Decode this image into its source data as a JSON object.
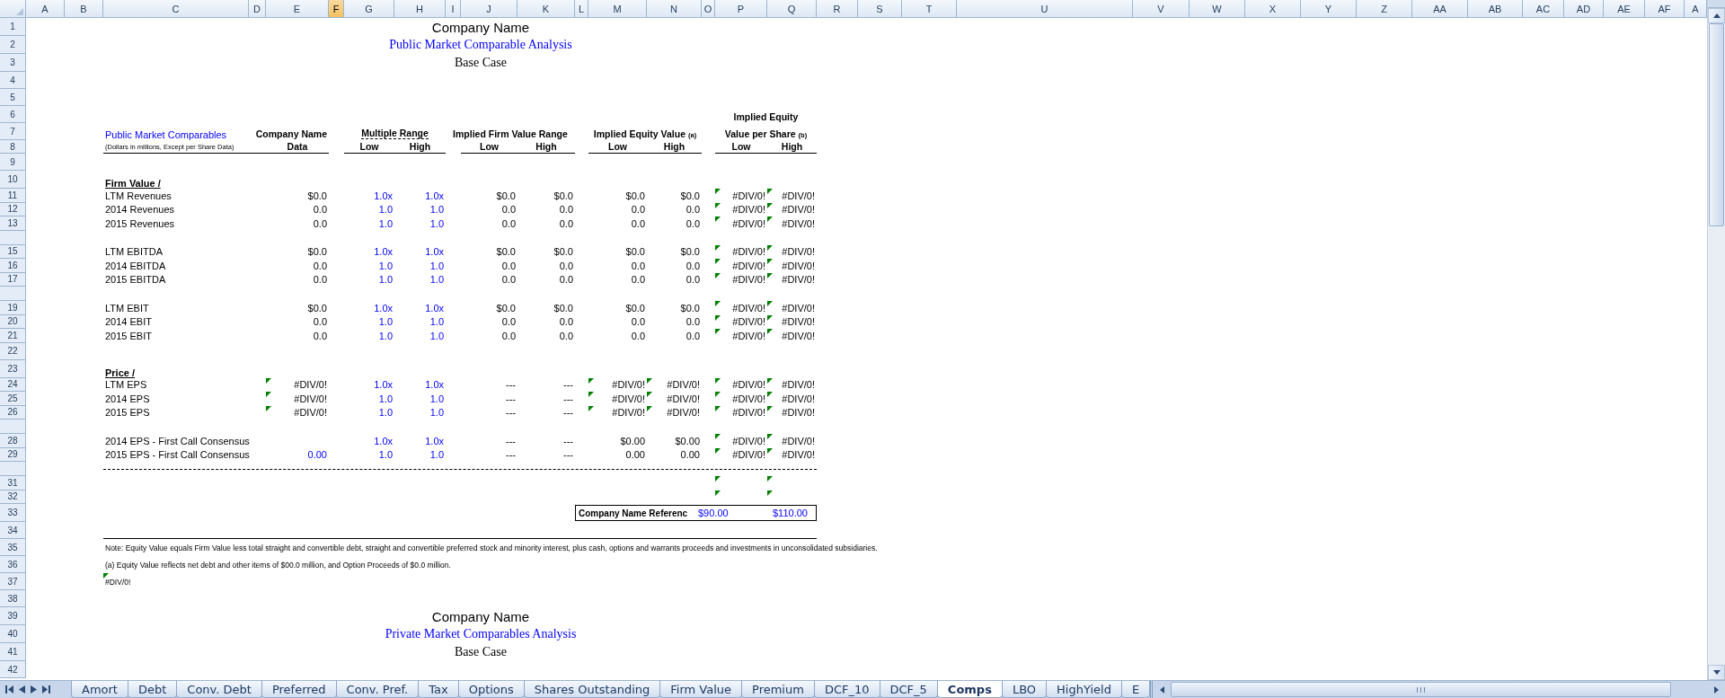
{
  "column_headers": [
    {
      "label": "A",
      "selected": false
    },
    {
      "label": "B",
      "selected": false
    },
    {
      "label": "C",
      "selected": false
    },
    {
      "label": "D",
      "selected": false
    },
    {
      "label": "E",
      "selected": false
    },
    {
      "label": "F",
      "selected": true
    },
    {
      "label": "G",
      "selected": false
    },
    {
      "label": "H",
      "selected": false
    },
    {
      "label": "I",
      "selected": false
    },
    {
      "label": "J",
      "selected": false
    },
    {
      "label": "K",
      "selected": false
    },
    {
      "label": "L",
      "selected": false
    },
    {
      "label": "M",
      "selected": false
    },
    {
      "label": "N",
      "selected": false
    },
    {
      "label": "O",
      "selected": false
    },
    {
      "label": "P",
      "selected": false
    },
    {
      "label": "Q",
      "selected": false
    },
    {
      "label": "R",
      "selected": false
    },
    {
      "label": "S",
      "selected": false
    },
    {
      "label": "T",
      "selected": false
    },
    {
      "label": "U",
      "selected": false
    },
    {
      "label": "V",
      "selected": false
    },
    {
      "label": "W",
      "selected": false
    },
    {
      "label": "X",
      "selected": false
    },
    {
      "label": "Y",
      "selected": false
    },
    {
      "label": "Z",
      "selected": false
    },
    {
      "label": "AA",
      "selected": false
    },
    {
      "label": "AB",
      "selected": false
    },
    {
      "label": "AC",
      "selected": false
    },
    {
      "label": "AD",
      "selected": false
    },
    {
      "label": "AE",
      "selected": false
    },
    {
      "label": "AF",
      "selected": false
    },
    {
      "label": "A",
      "selected": false
    }
  ],
  "sheet_rows": [
    {
      "kind": "heading",
      "number": "1",
      "text": "Company Name"
    },
    {
      "kind": "subtitle",
      "number": "2",
      "text": "Public Market Comparable Analysis"
    },
    {
      "kind": "caption",
      "number": "3",
      "text": "Base Case"
    },
    {
      "kind": "blank",
      "number": "4"
    },
    {
      "kind": "blank",
      "number": "5"
    },
    {
      "kind": "header_top",
      "number": "6",
      "text": "Implied Equity"
    },
    {
      "kind": "header",
      "number": "7",
      "section_title": "Public Market Comparables",
      "columns": [
        {
          "text": "Company Name"
        },
        {
          "text": "Multiple Range"
        },
        {
          "text": "Implied Firm Value Range"
        },
        {
          "text": "Implied Equity Value",
          "note": "(a)"
        },
        {
          "text": "Value per Share",
          "note": "(b)"
        }
      ]
    },
    {
      "kind": "subheader",
      "number": "8",
      "units": "(Dollars in millions, Except per Share Data)",
      "labels": [
        "Data",
        "Low",
        "High",
        "Low",
        "High",
        "Low",
        "High",
        "Low",
        "High"
      ]
    },
    {
      "kind": "blank",
      "number": "9"
    },
    {
      "kind": "section",
      "number": "10",
      "text": "Firm Value /"
    },
    {
      "kind": "metric",
      "number": "11",
      "label": "LTM Revenues",
      "cells": [
        {
          "text": "$0.0",
          "input": false,
          "flag": false
        },
        {
          "text": "1.0x",
          "input": true,
          "flag": false
        },
        {
          "text": "1.0x",
          "input": true,
          "flag": false
        },
        {
          "text": "$0.0",
          "input": false,
          "flag": false
        },
        {
          "text": "$0.0",
          "input": false,
          "flag": false
        },
        {
          "text": "$0.0",
          "input": false,
          "flag": false
        },
        {
          "text": "$0.0",
          "input": false,
          "flag": false
        },
        {
          "text": "#DIV/0!",
          "input": false,
          "flag": true
        },
        {
          "text": "#DIV/0!",
          "input": false,
          "flag": true
        }
      ]
    },
    {
      "kind": "metric",
      "number": "12",
      "label": "2014 Revenues",
      "cells": [
        {
          "text": "0.0",
          "input": false,
          "flag": false
        },
        {
          "text": "1.0",
          "input": true,
          "flag": false
        },
        {
          "text": "1.0",
          "input": true,
          "flag": false
        },
        {
          "text": "0.0",
          "input": false,
          "flag": false
        },
        {
          "text": "0.0",
          "input": false,
          "flag": false
        },
        {
          "text": "0.0",
          "input": false,
          "flag": false
        },
        {
          "text": "0.0",
          "input": false,
          "flag": false
        },
        {
          "text": "#DIV/0!",
          "input": false,
          "flag": true
        },
        {
          "text": "#DIV/0!",
          "input": false,
          "flag": true
        }
      ]
    },
    {
      "kind": "metric",
      "number": "13",
      "label": "2015 Revenues",
      "cells": [
        {
          "text": "0.0",
          "input": false,
          "flag": false
        },
        {
          "text": "1.0",
          "input": true,
          "flag": false
        },
        {
          "text": "1.0",
          "input": true,
          "flag": false
        },
        {
          "text": "0.0",
          "input": false,
          "flag": false
        },
        {
          "text": "0.0",
          "input": false,
          "flag": false
        },
        {
          "text": "0.0",
          "input": false,
          "flag": false
        },
        {
          "text": "0.0",
          "input": false,
          "flag": false
        },
        {
          "text": "#DIV/0!",
          "input": false,
          "flag": true
        },
        {
          "text": "#DIV/0!",
          "input": false,
          "flag": true
        }
      ]
    },
    {
      "kind": "spacer"
    },
    {
      "kind": "metric",
      "number": "15",
      "label": "LTM EBITDA",
      "cells": [
        {
          "text": "$0.0",
          "input": false,
          "flag": false
        },
        {
          "text": "1.0x",
          "input": true,
          "flag": false
        },
        {
          "text": "1.0x",
          "input": true,
          "flag": false
        },
        {
          "text": "$0.0",
          "input": false,
          "flag": false
        },
        {
          "text": "$0.0",
          "input": false,
          "flag": false
        },
        {
          "text": "$0.0",
          "input": false,
          "flag": false
        },
        {
          "text": "$0.0",
          "input": false,
          "flag": false
        },
        {
          "text": "#DIV/0!",
          "input": false,
          "flag": true
        },
        {
          "text": "#DIV/0!",
          "input": false,
          "flag": true
        }
      ]
    },
    {
      "kind": "metric",
      "number": "16",
      "label": "2014 EBITDA",
      "cells": [
        {
          "text": "0.0",
          "input": false,
          "flag": false
        },
        {
          "text": "1.0",
          "input": true,
          "flag": false
        },
        {
          "text": "1.0",
          "input": true,
          "flag": false
        },
        {
          "text": "0.0",
          "input": false,
          "flag": false
        },
        {
          "text": "0.0",
          "input": false,
          "flag": false
        },
        {
          "text": "0.0",
          "input": false,
          "flag": false
        },
        {
          "text": "0.0",
          "input": false,
          "flag": false
        },
        {
          "text": "#DIV/0!",
          "input": false,
          "flag": true
        },
        {
          "text": "#DIV/0!",
          "input": false,
          "flag": true
        }
      ]
    },
    {
      "kind": "metric",
      "number": "17",
      "label": "2015 EBITDA",
      "cells": [
        {
          "text": "0.0",
          "input": false,
          "flag": false
        },
        {
          "text": "1.0",
          "input": true,
          "flag": false
        },
        {
          "text": "1.0",
          "input": true,
          "flag": false
        },
        {
          "text": "0.0",
          "input": false,
          "flag": false
        },
        {
          "text": "0.0",
          "input": false,
          "flag": false
        },
        {
          "text": "0.0",
          "input": false,
          "flag": false
        },
        {
          "text": "0.0",
          "input": false,
          "flag": false
        },
        {
          "text": "#DIV/0!",
          "input": false,
          "flag": true
        },
        {
          "text": "#DIV/0!",
          "input": false,
          "flag": true
        }
      ]
    },
    {
      "kind": "spacer"
    },
    {
      "kind": "metric",
      "number": "19",
      "label": "LTM EBIT",
      "cells": [
        {
          "text": "$0.0",
          "input": false,
          "flag": false
        },
        {
          "text": "1.0x",
          "input": true,
          "flag": false
        },
        {
          "text": "1.0x",
          "input": true,
          "flag": false
        },
        {
          "text": "$0.0",
          "input": false,
          "flag": false
        },
        {
          "text": "$0.0",
          "input": false,
          "flag": false
        },
        {
          "text": "$0.0",
          "input": false,
          "flag": false
        },
        {
          "text": "$0.0",
          "input": false,
          "flag": false
        },
        {
          "text": "#DIV/0!",
          "input": false,
          "flag": true
        },
        {
          "text": "#DIV/0!",
          "input": false,
          "flag": true
        }
      ]
    },
    {
      "kind": "metric",
      "number": "20",
      "label": "2014 EBIT",
      "cells": [
        {
          "text": "0.0",
          "input": false,
          "flag": false
        },
        {
          "text": "1.0",
          "input": true,
          "flag": false
        },
        {
          "text": "1.0",
          "input": true,
          "flag": false
        },
        {
          "text": "0.0",
          "input": false,
          "flag": false
        },
        {
          "text": "0.0",
          "input": false,
          "flag": false
        },
        {
          "text": "0.0",
          "input": false,
          "flag": false
        },
        {
          "text": "0.0",
          "input": false,
          "flag": false
        },
        {
          "text": "#DIV/0!",
          "input": false,
          "flag": true
        },
        {
          "text": "#DIV/0!",
          "input": false,
          "flag": true
        }
      ]
    },
    {
      "kind": "metric",
      "number": "21",
      "label": "2015 EBIT",
      "cells": [
        {
          "text": "0.0",
          "input": false,
          "flag": false
        },
        {
          "text": "1.0",
          "input": true,
          "flag": false
        },
        {
          "text": "1.0",
          "input": true,
          "flag": false
        },
        {
          "text": "0.0",
          "input": false,
          "flag": false
        },
        {
          "text": "0.0",
          "input": false,
          "flag": false
        },
        {
          "text": "0.0",
          "input": false,
          "flag": false
        },
        {
          "text": "0.0",
          "input": false,
          "flag": false
        },
        {
          "text": "#DIV/0!",
          "input": false,
          "flag": true
        },
        {
          "text": "#DIV/0!",
          "input": false,
          "flag": true
        }
      ]
    },
    {
      "kind": "blank",
      "number": "22"
    },
    {
      "kind": "section",
      "number": "23",
      "text": "Price /"
    },
    {
      "kind": "metric",
      "number": "24",
      "label": "LTM EPS",
      "cells": [
        {
          "text": "#DIV/0!",
          "input": false,
          "flag": true
        },
        {
          "text": "1.0x",
          "input": true,
          "flag": false
        },
        {
          "text": "1.0x",
          "input": true,
          "flag": false
        },
        {
          "text": "---",
          "input": false,
          "flag": false
        },
        {
          "text": "---",
          "input": false,
          "flag": false
        },
        {
          "text": "#DIV/0!",
          "input": false,
          "flag": true
        },
        {
          "text": "#DIV/0!",
          "input": false,
          "flag": true
        },
        {
          "text": "#DIV/0!",
          "input": false,
          "flag": true
        },
        {
          "text": "#DIV/0!",
          "input": false,
          "flag": true
        }
      ]
    },
    {
      "kind": "metric",
      "number": "25",
      "label": "2014 EPS",
      "cells": [
        {
          "text": "#DIV/0!",
          "input": false,
          "flag": true
        },
        {
          "text": "1.0",
          "input": true,
          "flag": false
        },
        {
          "text": "1.0",
          "input": true,
          "flag": false
        },
        {
          "text": "---",
          "input": false,
          "flag": false
        },
        {
          "text": "---",
          "input": false,
          "flag": false
        },
        {
          "text": "#DIV/0!",
          "input": false,
          "flag": true
        },
        {
          "text": "#DIV/0!",
          "input": false,
          "flag": true
        },
        {
          "text": "#DIV/0!",
          "input": false,
          "flag": true
        },
        {
          "text": "#DIV/0!",
          "input": false,
          "flag": true
        }
      ]
    },
    {
      "kind": "metric",
      "number": "26",
      "label": "2015 EPS",
      "cells": [
        {
          "text": "#DIV/0!",
          "input": false,
          "flag": true
        },
        {
          "text": "1.0",
          "input": true,
          "flag": false
        },
        {
          "text": "1.0",
          "input": true,
          "flag": false
        },
        {
          "text": "---",
          "input": false,
          "flag": false
        },
        {
          "text": "---",
          "input": false,
          "flag": false
        },
        {
          "text": "#DIV/0!",
          "input": false,
          "flag": true
        },
        {
          "text": "#DIV/0!",
          "input": false,
          "flag": true
        },
        {
          "text": "#DIV/0!",
          "input": false,
          "flag": true
        },
        {
          "text": "#DIV/0!",
          "input": false,
          "flag": true
        }
      ]
    },
    {
      "kind": "spacer"
    },
    {
      "kind": "metric",
      "number": "28",
      "label": "2014 EPS - First Call Consensus",
      "cells": [
        null,
        {
          "text": "1.0x",
          "input": true,
          "flag": false
        },
        {
          "text": "1.0x",
          "input": true,
          "flag": false
        },
        {
          "text": "---",
          "input": false,
          "flag": false
        },
        {
          "text": "---",
          "input": false,
          "flag": false
        },
        {
          "text": "$0.00",
          "input": false,
          "flag": false
        },
        {
          "text": "$0.00",
          "input": false,
          "flag": false
        },
        {
          "text": "#DIV/0!",
          "input": false,
          "flag": true
        },
        {
          "text": "#DIV/0!",
          "input": false,
          "flag": true
        }
      ]
    },
    {
      "kind": "metric",
      "number": "29",
      "label": "2015 EPS - First Call Consensus",
      "cells": [
        {
          "text": "0.00",
          "input": true,
          "flag": false
        },
        {
          "text": "1.0",
          "input": true,
          "flag": false
        },
        {
          "text": "1.0",
          "input": true,
          "flag": false
        },
        {
          "text": "---",
          "input": false,
          "flag": false
        },
        {
          "text": "---",
          "input": false,
          "flag": false
        },
        {
          "text": "0.00",
          "input": false,
          "flag": false
        },
        {
          "text": "0.00",
          "input": false,
          "flag": false
        },
        {
          "text": "#DIV/0!",
          "input": false,
          "flag": true
        },
        {
          "text": "#DIV/0!",
          "input": false,
          "flag": true
        }
      ]
    },
    {
      "kind": "spacer",
      "dotted_rule": true
    },
    {
      "kind": "metric",
      "number": "31",
      "cells": [
        null,
        null,
        null,
        null,
        null,
        null,
        null,
        {
          "flag": true
        },
        {
          "flag": true
        }
      ]
    },
    {
      "kind": "metric",
      "number": "32",
      "cells": [
        null,
        null,
        null,
        null,
        null,
        null,
        null,
        {
          "flag": true
        },
        {
          "flag": true
        }
      ]
    },
    {
      "kind": "reference",
      "number": "33",
      "label": "Company Name Referenc",
      "values": [
        "$90.00",
        "$110.00"
      ]
    },
    {
      "kind": "blank",
      "number": "34",
      "rule_below": true
    },
    {
      "kind": "note",
      "number": "35",
      "text": "Note:  Equity Value equals Firm Value less total straight and convertible debt, straight and convertible preferred stock and minority interest, plus cash, options and warrants proceeds and investments in unconsolidated subsidiaries."
    },
    {
      "kind": "note",
      "number": "36",
      "text": "(a)  Equity Value reflects net debt and other items of $00.0 million, and Option Proceeds of $0.0 million."
    },
    {
      "kind": "note",
      "number": "37",
      "text": "#DIV/0!",
      "flag": true
    },
    {
      "kind": "blank",
      "number": "38"
    },
    {
      "kind": "heading",
      "number": "39",
      "text": "Company Name"
    },
    {
      "kind": "subtitle",
      "number": "40",
      "text": "Private Market Comparables Analysis"
    },
    {
      "kind": "caption",
      "number": "41",
      "text": "Base Case"
    },
    {
      "kind": "blank",
      "number": "42"
    }
  ],
  "sheet_tabs": [
    {
      "label": "Amort",
      "selected": false
    },
    {
      "label": "Debt",
      "selected": false
    },
    {
      "label": "Conv. Debt",
      "selected": false
    },
    {
      "label": "Preferred",
      "selected": false
    },
    {
      "label": "Conv. Pref.",
      "selected": false
    },
    {
      "label": "Tax",
      "selected": false
    },
    {
      "label": "Options",
      "selected": false
    },
    {
      "label": "Shares Outstanding",
      "selected": false
    },
    {
      "label": "Firm Value",
      "selected": false
    },
    {
      "label": "Premium",
      "selected": false
    },
    {
      "label": "DCF_10",
      "selected": false
    },
    {
      "label": "DCF_5",
      "selected": false
    },
    {
      "label": "Comps",
      "selected": true
    },
    {
      "label": "LBO",
      "selected": false
    },
    {
      "label": "HighYield",
      "selected": false
    },
    {
      "label": "E",
      "selected": false
    }
  ]
}
